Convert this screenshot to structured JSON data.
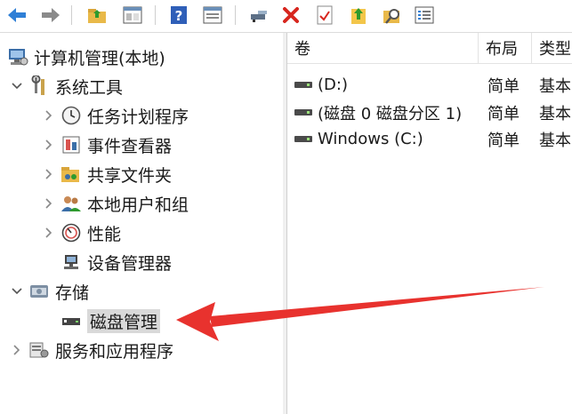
{
  "toolbar": {
    "icons": [
      "back-arrow-icon",
      "forward-arrow-icon",
      "up-folder-icon",
      "show-hide-tree-icon",
      "help-icon",
      "properties-pane-icon",
      "connect-icon",
      "delete-icon",
      "check-document-icon",
      "import-icon",
      "search-folder-icon",
      "list-view-icon"
    ]
  },
  "tree": {
    "root": "计算机管理(本地)",
    "system_tools": "系统工具",
    "task_scheduler": "任务计划程序",
    "event_viewer": "事件查看器",
    "shared_folders": "共享文件夹",
    "local_users": "本地用户和组",
    "performance": "性能",
    "device_manager": "设备管理器",
    "storage": "存储",
    "disk_management": "磁盘管理",
    "services_apps": "服务和应用程序"
  },
  "list": {
    "columns": [
      "卷",
      "布局",
      "类型"
    ],
    "rows": [
      {
        "volume": "(D:)",
        "layout": "简单",
        "type": "基本"
      },
      {
        "volume": "(磁盘 0 磁盘分区 1)",
        "layout": "简单",
        "type": "基本"
      },
      {
        "volume": "Windows (C:)",
        "layout": "简单",
        "type": "基本"
      }
    ]
  },
  "annotation": {
    "color": "#e8322e"
  }
}
